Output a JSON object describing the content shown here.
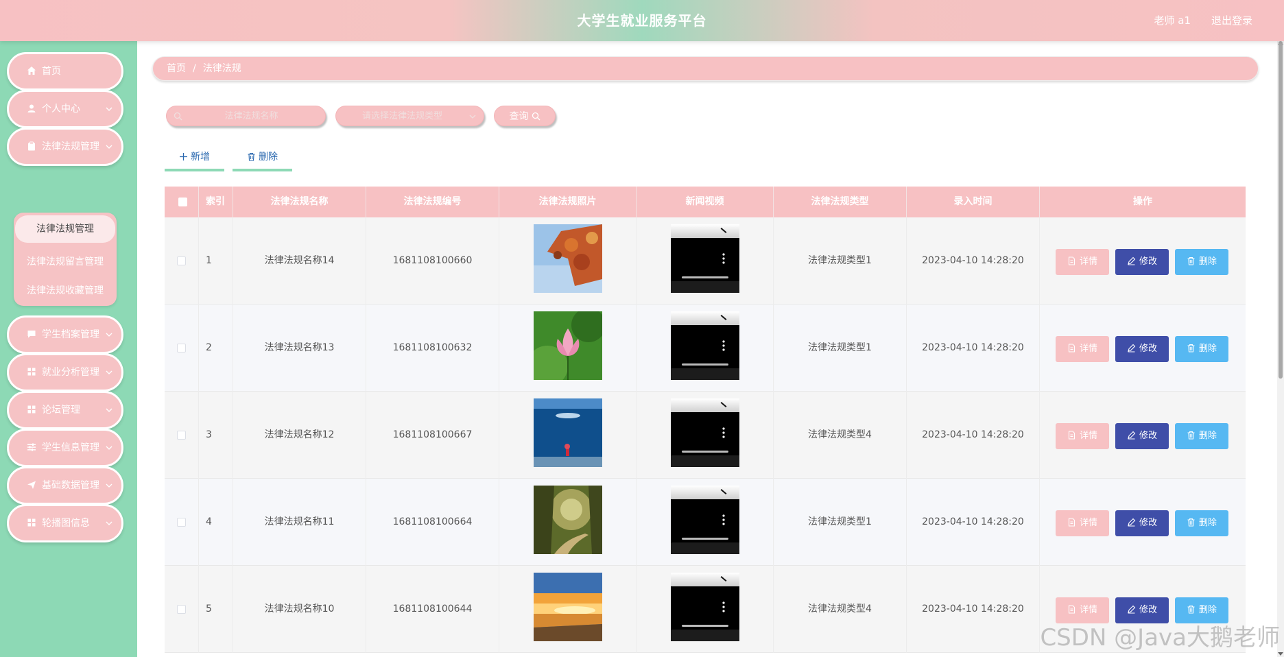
{
  "header": {
    "title": "大学生就业服务平台",
    "user": "老师 a1",
    "logout": "退出登录"
  },
  "sidebar": {
    "items": [
      {
        "label": "首页",
        "icon": "home-icon"
      },
      {
        "label": "个人中心",
        "icon": "user-icon"
      },
      {
        "label": "法律法规管理",
        "icon": "clipboard-icon"
      },
      {
        "label": "学生档案管理",
        "icon": "chat-icon"
      },
      {
        "label": "就业分析管理",
        "icon": "grid-icon"
      },
      {
        "label": "论坛管理",
        "icon": "grid-icon"
      },
      {
        "label": "学生信息管理",
        "icon": "sliders-icon"
      },
      {
        "label": "基础数据管理",
        "icon": "send-icon"
      },
      {
        "label": "轮播图信息",
        "icon": "grid-icon"
      }
    ],
    "submenu": [
      "法律法规管理",
      "法律法规留言管理",
      "法律法规收藏管理"
    ]
  },
  "breadcrumb": {
    "home": "首页",
    "sep": "/",
    "current": "法律法规"
  },
  "search": {
    "name_placeholder": "法律法规名称",
    "type_placeholder": "请选择法律法规类型",
    "button": "查询"
  },
  "toolbar": {
    "add": "新增",
    "delete": "删除"
  },
  "table": {
    "headers": [
      "索引",
      "法律法规名称",
      "法律法规编号",
      "法律法规照片",
      "新闻视频",
      "法律法规类型",
      "录入时间",
      "操作"
    ],
    "rows": [
      {
        "index": "1",
        "name": "法律法规名称14",
        "code": "1681108100660",
        "type": "法律法规类型1",
        "time": "2023-04-10 14:28:20"
      },
      {
        "index": "2",
        "name": "法律法规名称13",
        "code": "1681108100632",
        "type": "法律法规类型1",
        "time": "2023-04-10 14:28:20"
      },
      {
        "index": "3",
        "name": "法律法规名称12",
        "code": "1681108100667",
        "type": "法律法规类型4",
        "time": "2023-04-10 14:28:20"
      },
      {
        "index": "4",
        "name": "法律法规名称11",
        "code": "1681108100664",
        "type": "法律法规类型1",
        "time": "2023-04-10 14:28:20"
      },
      {
        "index": "5",
        "name": "法律法规名称10",
        "code": "1681108100644",
        "type": "法律法规类型4",
        "time": "2023-04-10 14:28:20"
      }
    ],
    "actions": {
      "detail": "详情",
      "edit": "修改",
      "delete": "删除"
    }
  },
  "watermark": "CSDN @Java大鹅老师",
  "colors": {
    "header_pink": "#f7c1c3",
    "sidebar_green": "#8dd9b5",
    "edit_blue": "#3f4ea8",
    "delete_blue": "#56b8f2"
  }
}
